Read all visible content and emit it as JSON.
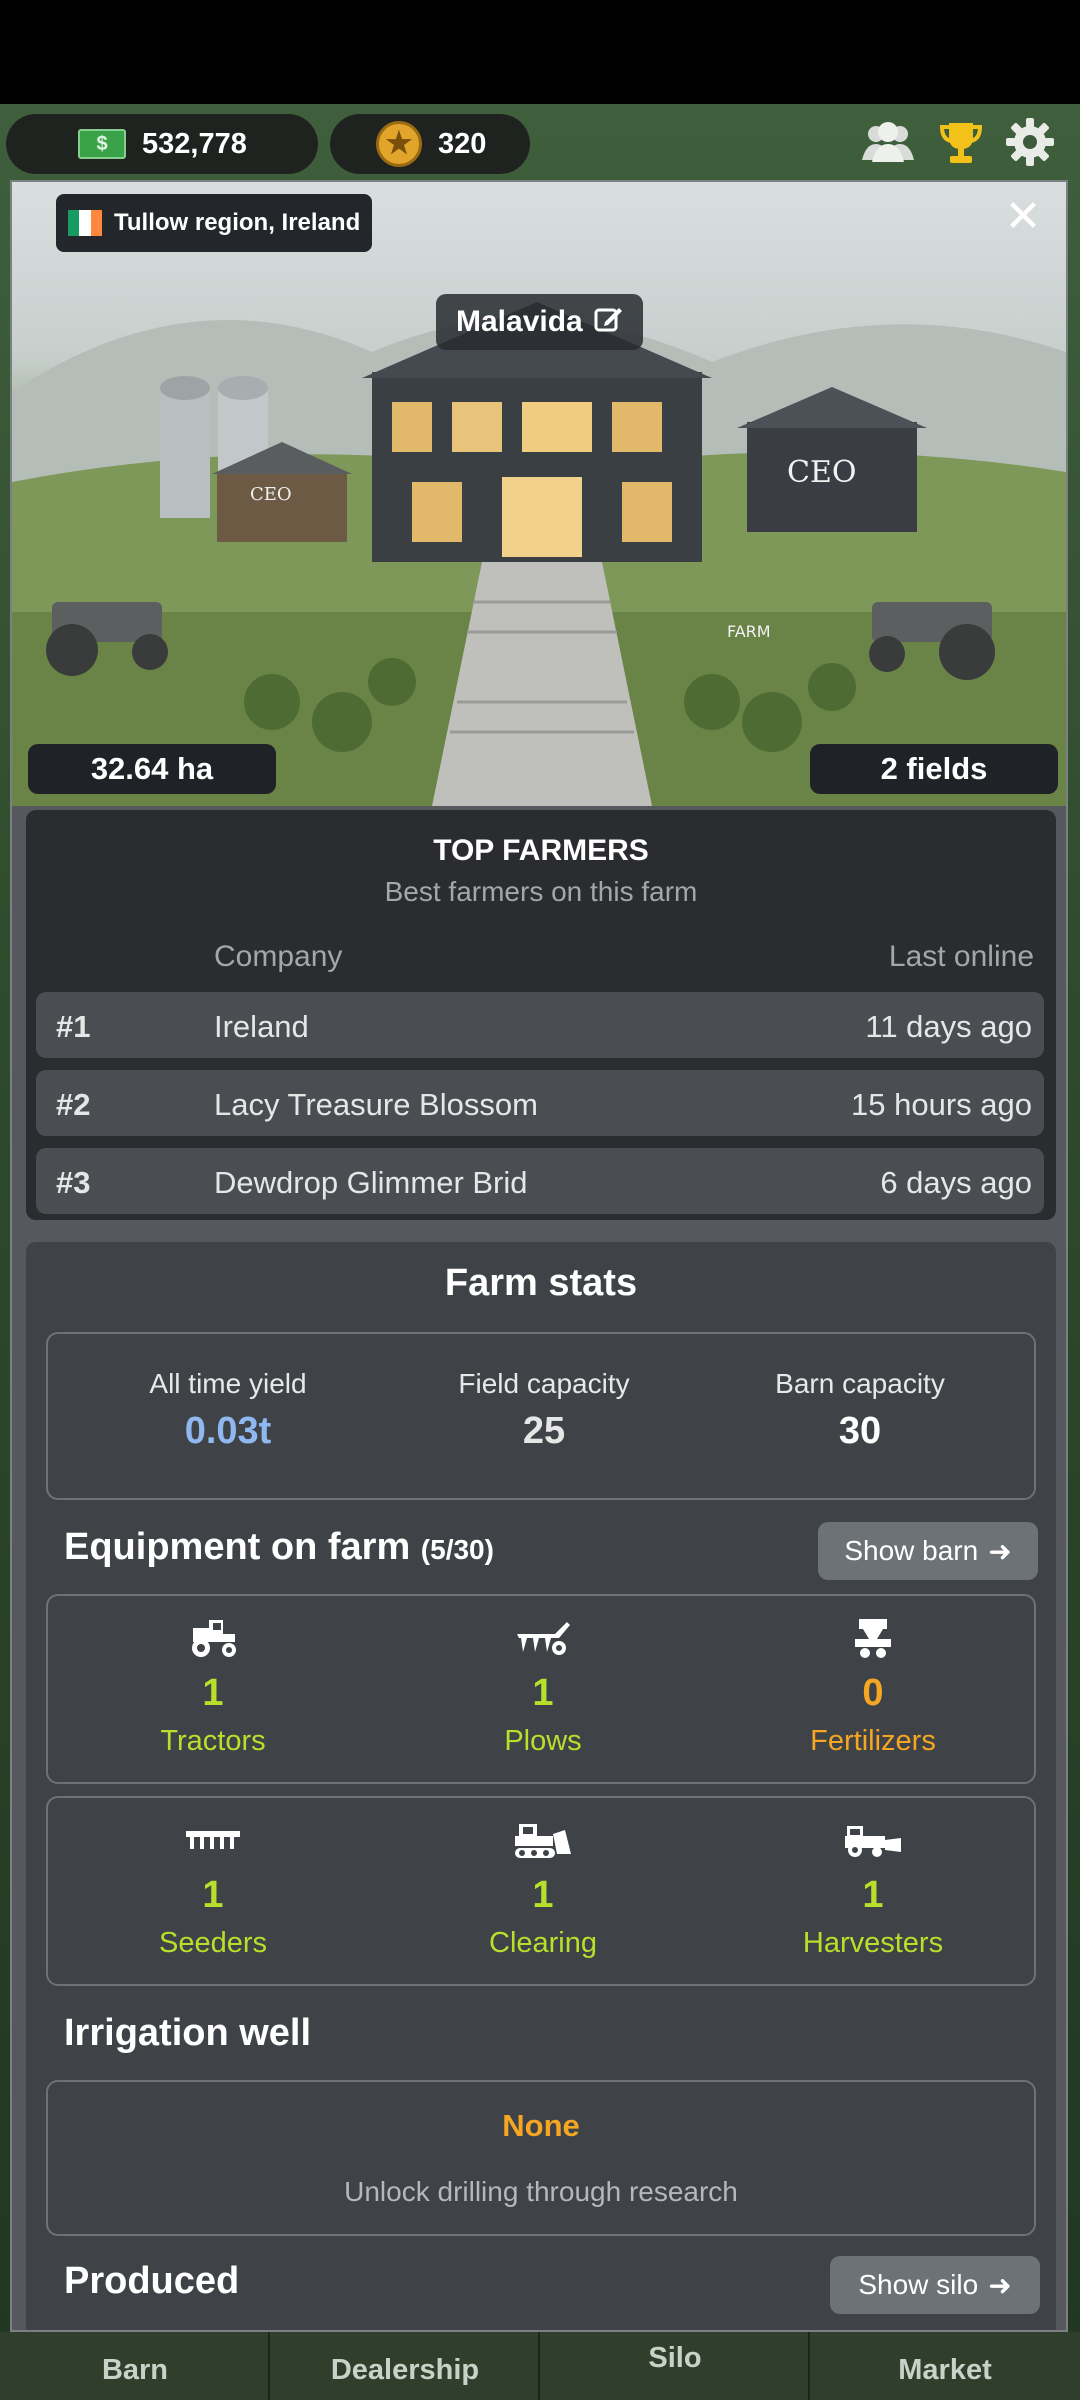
{
  "top_bar": {
    "money": "532,778",
    "stars": "320",
    "icons": [
      "community-icon",
      "trophy-icon",
      "gear-icon"
    ]
  },
  "farm": {
    "region": "Tullow region, Ireland",
    "name": "Malavida",
    "area": "32.64 ha",
    "fields": "2 fields",
    "image_labels": [
      "CEO",
      "CEO",
      "FARM"
    ]
  },
  "top_farmers": {
    "title": "TOP FARMERS",
    "subtitle": "Best farmers on this farm",
    "col_company": "Company",
    "col_last_online": "Last online",
    "rows": [
      {
        "rank": "#1",
        "company": "Ireland",
        "last": "11 days ago"
      },
      {
        "rank": "#2",
        "company": "Lacy Treasure Blossom",
        "last": "15 hours ago"
      },
      {
        "rank": "#3",
        "company": "Dewdrop Glimmer Brid",
        "last": "6 days ago"
      }
    ]
  },
  "farm_stats": {
    "title": "Farm stats",
    "stats": [
      {
        "label": "All time yield",
        "value": "0.03t",
        "color": "#8fb8f0"
      },
      {
        "label": "Field capacity",
        "value": "25",
        "color": "#e6e6e6"
      },
      {
        "label": "Barn capacity",
        "value": "30",
        "color": "#ffffff"
      }
    ]
  },
  "equipment": {
    "title": "Equipment on farm",
    "count": "(5/30)",
    "button": "Show barn",
    "items": [
      {
        "count": "1",
        "label": "Tractors",
        "icon": "tractor-icon",
        "color": "#b6e02b"
      },
      {
        "count": "1",
        "label": "Plows",
        "icon": "plow-icon",
        "color": "#b6e02b"
      },
      {
        "count": "0",
        "label": "Fertilizers",
        "icon": "fertilizer-icon",
        "color": "#f5a623"
      },
      {
        "count": "1",
        "label": "Seeders",
        "icon": "seeder-icon",
        "color": "#b6e02b"
      },
      {
        "count": "1",
        "label": "Clearing",
        "icon": "bulldozer-icon",
        "color": "#b6e02b"
      },
      {
        "count": "1",
        "label": "Harvesters",
        "icon": "harvester-icon",
        "color": "#b6e02b"
      }
    ]
  },
  "irrigation": {
    "title": "Irrigation well",
    "status": "None",
    "note": "Unlock drilling through research"
  },
  "produced": {
    "title": "Produced",
    "button": "Show silo"
  },
  "nav": {
    "items": [
      "Barn",
      "Dealership",
      "Silo",
      "Market"
    ]
  }
}
